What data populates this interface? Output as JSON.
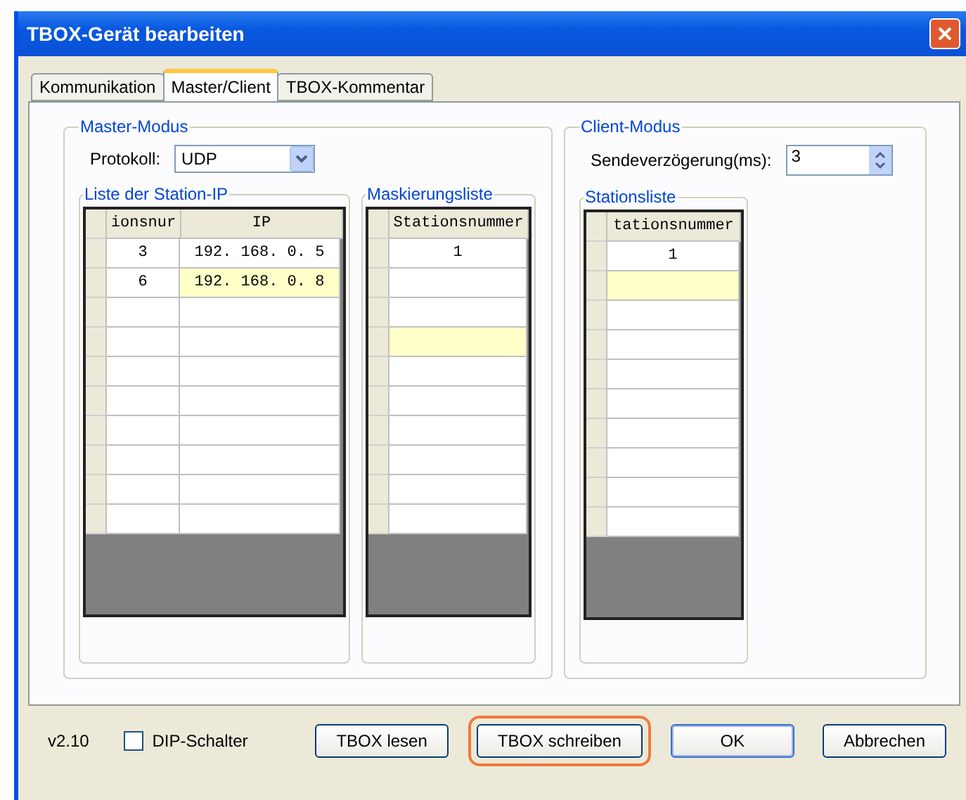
{
  "window": {
    "title": "TBOX-Gerät bearbeiten"
  },
  "tabs": [
    {
      "label": "Kommunikation",
      "selected": false
    },
    {
      "label": "Master/Client",
      "selected": true
    },
    {
      "label": "TBOX-Kommentar",
      "selected": false
    }
  ],
  "master": {
    "title": "Master-Modus",
    "protocol_label": "Protokoll:",
    "protocol_value": "UDP",
    "grids": [
      {
        "title": "Liste der Station-IP",
        "columns": [
          "ionsnur",
          "IP"
        ],
        "rows": [
          {
            "cells": [
              {
                "text": "3",
                "selected": false
              },
              {
                "text": "192. 168. 0. 5",
                "selected": false
              }
            ]
          },
          {
            "cells": [
              {
                "text": "6",
                "selected": false
              },
              {
                "text": "192. 168. 0. 8",
                "selected": true
              }
            ]
          },
          {
            "cells": [
              {
                "selected": false
              },
              {
                "selected": false
              }
            ]
          },
          {
            "cells": [
              {
                "selected": false
              },
              {
                "selected": false
              }
            ]
          },
          {
            "cells": [
              {
                "selected": false
              },
              {
                "selected": false
              }
            ]
          },
          {
            "cells": [
              {
                "selected": false
              },
              {
                "selected": false
              }
            ]
          },
          {
            "cells": [
              {
                "selected": false
              },
              {
                "selected": false
              }
            ]
          },
          {
            "cells": [
              {
                "selected": false
              },
              {
                "selected": false
              }
            ]
          },
          {
            "cells": [
              {
                "selected": false
              },
              {
                "selected": false
              }
            ]
          },
          {
            "cells": [
              {
                "selected": false
              },
              {
                "selected": false
              }
            ]
          }
        ]
      },
      {
        "title": "Maskierungsliste",
        "columns": [
          "Stationsnummer"
        ],
        "rows": [
          {
            "cells": [
              {
                "text": "1",
                "selected": false
              }
            ]
          },
          {
            "cells": [
              {
                "selected": false
              }
            ]
          },
          {
            "cells": [
              {
                "selected": false
              }
            ]
          },
          {
            "cells": [
              {
                "selected": true
              }
            ]
          },
          {
            "cells": [
              {
                "selected": false
              }
            ]
          },
          {
            "cells": [
              {
                "selected": false
              }
            ]
          },
          {
            "cells": [
              {
                "selected": false
              }
            ]
          },
          {
            "cells": [
              {
                "selected": false
              }
            ]
          },
          {
            "cells": [
              {
                "selected": false
              }
            ]
          },
          {
            "cells": [
              {
                "selected": false
              }
            ]
          }
        ]
      }
    ]
  },
  "client": {
    "title": "Client-Modus",
    "delay_label": "Sendeverzögerung(ms):",
    "delay_value": "3",
    "grids": [
      {
        "title": "Stationsliste",
        "columns": [
          "tationsnummer"
        ],
        "rows": [
          {
            "cells": [
              {
                "text": "1",
                "selected": false
              }
            ]
          },
          {
            "cells": [
              {
                "selected": true
              }
            ]
          },
          {
            "cells": [
              {
                "selected": false
              }
            ]
          },
          {
            "cells": [
              {
                "selected": false
              }
            ]
          },
          {
            "cells": [
              {
                "selected": false
              }
            ]
          },
          {
            "cells": [
              {
                "selected": false
              }
            ]
          },
          {
            "cells": [
              {
                "selected": false
              }
            ]
          },
          {
            "cells": [
              {
                "selected": false
              }
            ]
          },
          {
            "cells": [
              {
                "selected": false
              }
            ]
          },
          {
            "cells": [
              {
                "selected": false
              }
            ]
          }
        ]
      }
    ]
  },
  "footer": {
    "version": "v2.10",
    "dip": {
      "label": "DIP-Schalter",
      "checked": false
    },
    "buttons": [
      {
        "label": "TBOX lesen",
        "default": false,
        "highlighted": false
      },
      {
        "label": "TBOX schreiben",
        "default": false,
        "highlighted": true
      },
      {
        "label": "OK",
        "default": true,
        "highlighted": false
      },
      {
        "label": "Abbrechen",
        "default": false,
        "highlighted": false
      }
    ]
  }
}
